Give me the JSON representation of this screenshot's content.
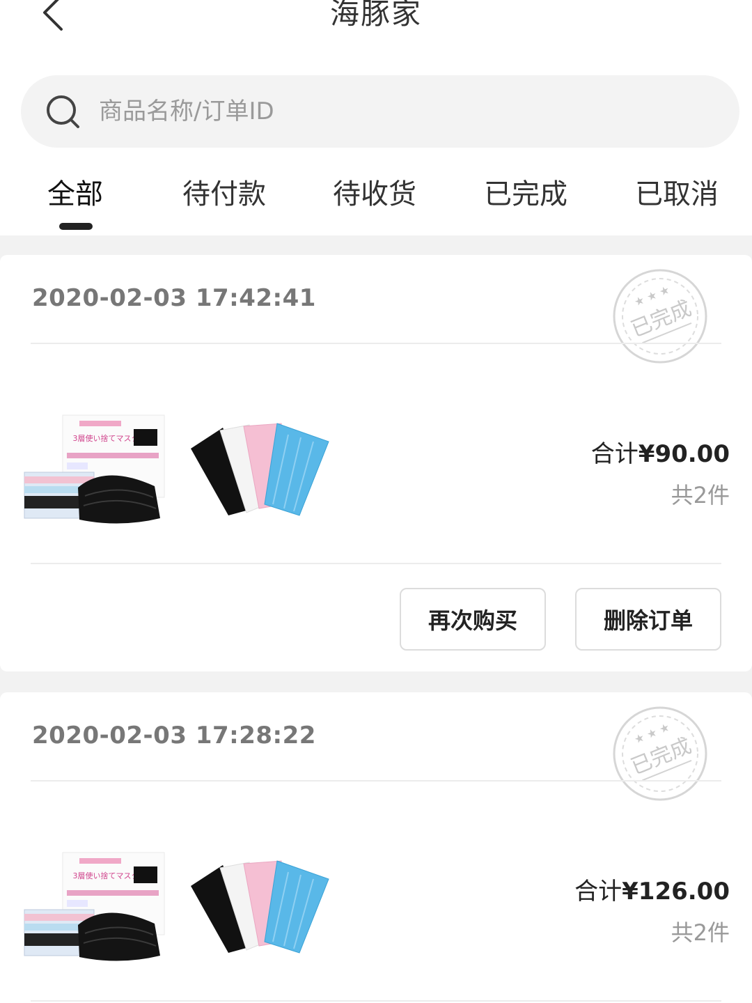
{
  "header": {
    "title": "海豚家",
    "back_icon": "chevron-left-icon"
  },
  "search": {
    "placeholder": "商品名称/订单ID",
    "value": "",
    "icon": "search-icon"
  },
  "tabs": [
    {
      "label": "全部",
      "active": true
    },
    {
      "label": "待付款",
      "active": false
    },
    {
      "label": "待收货",
      "active": false
    },
    {
      "label": "已完成",
      "active": false
    },
    {
      "label": "已取消",
      "active": false
    }
  ],
  "orders": [
    {
      "time": "2020-02-03 17:42:41",
      "status_stamp": "已完成",
      "total_prefix": "合计",
      "total": "¥90.00",
      "count": "共2件",
      "buttons": {
        "buy_again": "再次购买",
        "delete": "删除订单"
      }
    },
    {
      "time": "2020-02-03 17:28:22",
      "status_stamp": "已完成",
      "total_prefix": "合计",
      "total": "¥126.00",
      "count": "共2件"
    }
  ],
  "product_images": {
    "box_text": "3層使い捨てマスク"
  },
  "colors": {
    "accent": "#222222",
    "muted_text": "#999999",
    "background": "#f2f2f2",
    "mask_blue": "#4fb6e6",
    "mask_pink": "#f5b8cf",
    "mask_black": "#111111"
  }
}
